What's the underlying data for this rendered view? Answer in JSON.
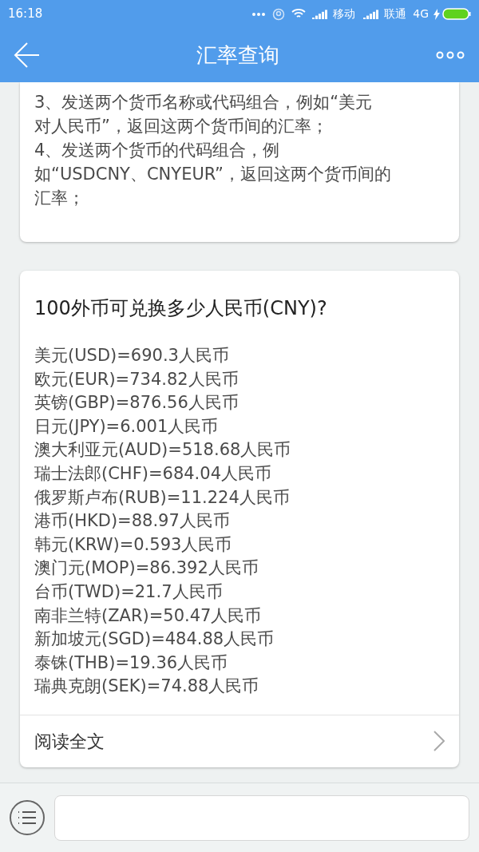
{
  "status_bar": {
    "time": "16:18",
    "carrier_1": "移动",
    "carrier_2": "联通",
    "network": "4G"
  },
  "header": {
    "title": "汇率查询"
  },
  "help_card": {
    "lines": [
      "3、发送两个货币名称或代码组合，例如“美元",
      "对人民币”，返回这两个货币间的汇率；",
      "4、发送两个货币的代码组合，例",
      "如“USDCNY、CNYEUR”，返回这两个货币间的",
      "汇率；"
    ]
  },
  "rates_card": {
    "title": "100外币可兑换多少人民币(CNY)?",
    "rates": [
      "美元(USD)=690.3人民币",
      "欧元(EUR)=734.82人民币",
      "英镑(GBP)=876.56人民币",
      "日元(JPY)=6.001人民币",
      "澳大利亚元(AUD)=518.68人民币",
      "瑞士法郎(CHF)=684.04人民币",
      "俄罗斯卢布(RUB)=11.224人民币",
      "港币(HKD)=88.97人民币",
      "韩元(KRW)=0.593人民币",
      "澳门元(MOP)=86.392人民币",
      "台币(TWD)=21.7人民币",
      "南非兰特(ZAR)=50.47人民币",
      "新加坡元(SGD)=484.88人民币",
      "泰铢(THB)=19.36人民币",
      "瑞典克朗(SEK)=74.88人民币"
    ],
    "read_more": "阅读全文"
  }
}
